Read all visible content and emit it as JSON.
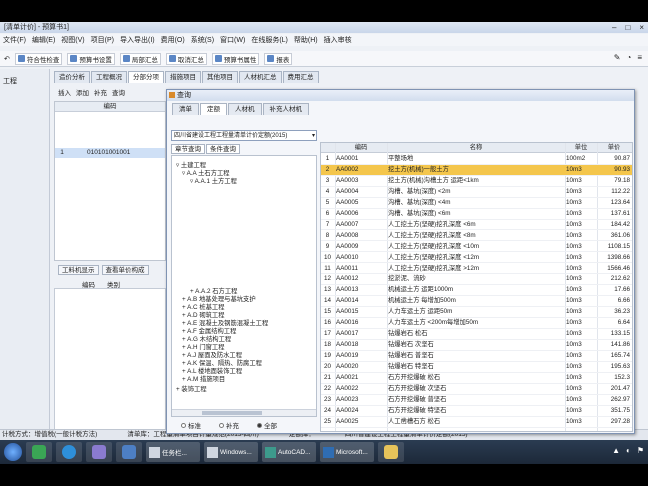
{
  "app": {
    "title": "[清单计价] - 预算书1]",
    "window_controls": [
      "–",
      "□",
      "×"
    ]
  },
  "menubar": [
    "文件(F)",
    "编辑(E)",
    "视图(V)",
    "项目(P)",
    "导入导出(I)",
    "费用(O)",
    "系统(S)",
    "窗口(W)",
    "在线服务(L)",
    "帮助(H)",
    "插入审核"
  ],
  "toolbar": {
    "undo": "↶",
    "buttons": [
      "符合性检查",
      "预算书设置",
      "局部汇总",
      "取消汇总",
      "预算书属性",
      "报表"
    ],
    "right_icons": [
      "✎",
      "◔",
      "≡"
    ]
  },
  "main_tabs": [
    "造价分析",
    "工程概况",
    "分部分项",
    "措施项目",
    "其他项目",
    "人材机汇总",
    "费用汇总"
  ],
  "main_active_tab": 2,
  "left_panel": {
    "label": "工程"
  },
  "sub_toolbar": [
    "插入",
    "添加",
    "补充",
    "查询"
  ],
  "mid_table": {
    "header": "编码",
    "row": {
      "num": "1",
      "code": "010101001001"
    }
  },
  "bottom_tabs": [
    "工料机显示",
    "查看单价构成"
  ],
  "bottom_cols": [
    "编码",
    "类别"
  ],
  "statusbar": [
    "计税方式：增值税(一般计税方法)",
    "清单库：工程量清单项目计量规范(2013-四川)",
    "定额库：",
    "四川省建设工程工程量清单计价定额(2015)"
  ],
  "dialog": {
    "title": "查询",
    "tabs": [
      "清单",
      "定额",
      "人材机",
      "补充人材机"
    ],
    "active_tab": 1,
    "sub_tabs": [
      "查询",
      "人材机",
      "补充人材机"
    ],
    "library": "四川省建设工程工程量清单计价定额(2015)",
    "tree_tabs": [
      "章节查询",
      "条件查询"
    ],
    "tree": [
      "▿ 土建工程",
      "▿ A.A  土石方工程",
      "▿ A.A.1  土方工程",
      "+ A.A.2  石方工程",
      "+ A.B  地基处理与基坑支护",
      "+ A.C  桩基工程",
      "+ A.D  砌筑工程",
      "+ A.E  混凝土及钢筋混凝土工程",
      "+ A.F  金属结构工程",
      "+ A.G  木结构工程",
      "+ A.H  门窗工程",
      "+ A.J  屋面及防水工程",
      "+ A.K  保温、隔热、防腐工程",
      "+ A.L  楼地面装饰工程",
      "+ A.M  措施项目",
      "+ 装饰工程"
    ],
    "radios": [
      "标准",
      "补充",
      "全部"
    ],
    "radio_selected": 2,
    "grid": {
      "headers": [
        "",
        "编码",
        "名称",
        "单位",
        "单价"
      ],
      "rows": [
        [
          "1",
          "AA0001",
          "平整场地",
          "100m2",
          "90.87"
        ],
        [
          "2",
          "AA0002",
          "挖土方(机械)一般土方",
          "10m3",
          "90.93"
        ],
        [
          "3",
          "AA0003",
          "挖土方(机械)沟槽土方 运距<1km",
          "10m3",
          "79.18"
        ],
        [
          "4",
          "AA0004",
          "沟槽、基坑(深度) <2m",
          "10m3",
          "112.22"
        ],
        [
          "5",
          "AA0005",
          "沟槽、基坑(深度) <4m",
          "10m3",
          "123.64"
        ],
        [
          "6",
          "AA0006",
          "沟槽、基坑(深度) <6m",
          "10m3",
          "137.61"
        ],
        [
          "7",
          "AA0007",
          "人工挖土方(坚硬)挖孔深度 <6m",
          "10m3",
          "184.42"
        ],
        [
          "8",
          "AA0008",
          "人工挖土方(坚硬)挖孔深度 <8m",
          "10m3",
          "361.06"
        ],
        [
          "9",
          "AA0009",
          "人工挖土方(坚硬)挖孔深度 <10m",
          "10m3",
          "1108.15"
        ],
        [
          "10",
          "AA0010",
          "人工挖土方(坚硬)挖孔深度 <12m",
          "10m3",
          "1398.66"
        ],
        [
          "11",
          "AA0011",
          "人工挖土方(坚硬)挖孔深度 >12m",
          "10m3",
          "1566.46"
        ],
        [
          "12",
          "AA0012",
          "挖淤泥、流砂",
          "10m3",
          "212.62"
        ],
        [
          "13",
          "AA0013",
          "机械运土方 运距1000m",
          "10m3",
          "17.66"
        ],
        [
          "14",
          "AA0014",
          "机械运土方 每增加500m",
          "10m3",
          "6.66"
        ],
        [
          "15",
          "AA0015",
          "人力车运土方 运距50m",
          "10m3",
          "36.23"
        ],
        [
          "16",
          "AA0016",
          "人力车运土方 <200m每增加50m",
          "10m3",
          "6.64"
        ],
        [
          "17",
          "AA0017",
          "钻爆岩石 松石",
          "10m3",
          "133.15"
        ],
        [
          "18",
          "AA0018",
          "钻爆岩石 次坚石",
          "10m3",
          "141.86"
        ],
        [
          "19",
          "AA0019",
          "钻爆岩石 普坚石",
          "10m3",
          "165.74"
        ],
        [
          "20",
          "AA0020",
          "钻爆岩石 特坚石",
          "10m3",
          "195.63"
        ],
        [
          "21",
          "AA0021",
          "石方开挖爆破 松石",
          "10m3",
          "152.3"
        ],
        [
          "22",
          "AA0022",
          "石方开挖爆破 次坚石",
          "10m3",
          "201.47"
        ],
        [
          "23",
          "AA0023",
          "石方开挖爆破 普坚石",
          "10m3",
          "262.97"
        ],
        [
          "24",
          "AA0024",
          "石方开挖爆破 特坚石",
          "10m3",
          "351.75"
        ],
        [
          "25",
          "AA0025",
          "人工凿槽石方 松石",
          "10m3",
          "297.28"
        ]
      ],
      "selected_row": 1
    }
  },
  "taskbar": {
    "tasks": [
      "任务栏...",
      "Windows...",
      "AutoCAD...",
      "Microsoft..."
    ],
    "tray": [
      "▲",
      "◐",
      "⚑"
    ]
  },
  "colors": {
    "selected_row": "#f4c64c",
    "dialog_border": "#7f93b3",
    "taskbar": "#1c2838"
  }
}
